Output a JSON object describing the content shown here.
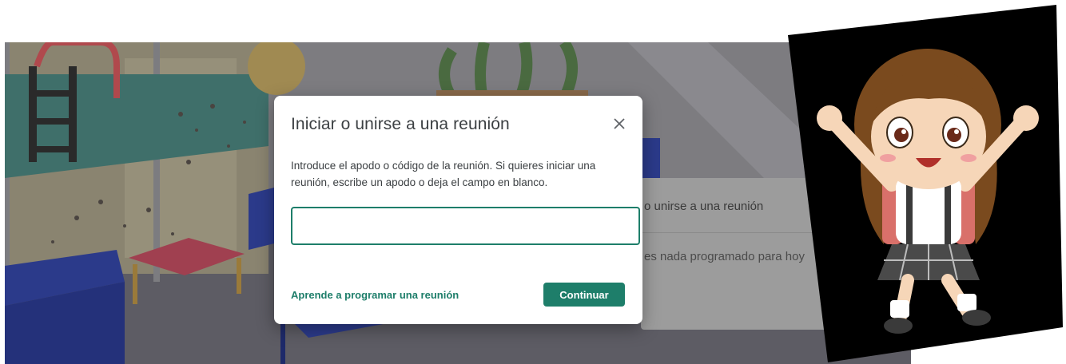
{
  "background": {
    "card_row_1": "o unirse a una reunión",
    "card_row_2": "es nada programado para hoy"
  },
  "dialog": {
    "title": "Iniciar o unirse a una reunión",
    "description": "Introduce el apodo o código de la reunión. Si quieres iniciar una reunión, escribe un apodo o deja el campo en blanco.",
    "input_value": "",
    "learn_link": "Aprende a programar una reunión",
    "continue_label": "Continuar",
    "close_icon": "close-icon"
  },
  "colors": {
    "accent": "#1e7e6a",
    "title_text": "#3c4043",
    "sticker_bg": "#000000"
  },
  "sticker": {
    "subject": "cartoon girl with backpack jumping"
  }
}
